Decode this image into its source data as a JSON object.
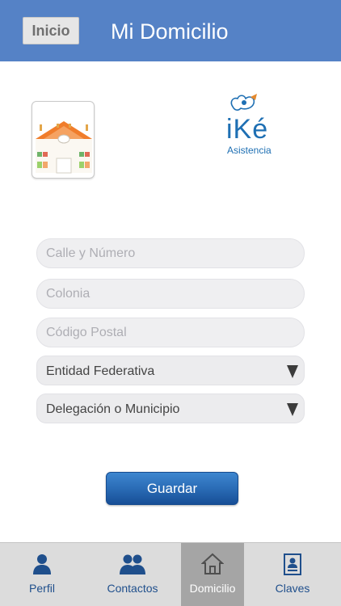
{
  "header": {
    "back_label": "Inicio",
    "title": "Mi Domicilio"
  },
  "logo": {
    "brand": "iKé",
    "subtitle": "Asistencia"
  },
  "form": {
    "street": {
      "placeholder": "Calle y Número",
      "value": ""
    },
    "colony": {
      "placeholder": "Colonia",
      "value": ""
    },
    "postal": {
      "placeholder": "Código Postal",
      "value": ""
    },
    "state": {
      "selected": "Entidad Federativa"
    },
    "municipality": {
      "selected": "Delegación o Municipio"
    }
  },
  "save_label": "Guardar",
  "tabs": [
    {
      "label": "Perfil",
      "icon": "person-icon",
      "active": false
    },
    {
      "label": "Contactos",
      "icon": "contacts-icon",
      "active": false
    },
    {
      "label": "Domicilio",
      "icon": "home-icon",
      "active": true
    },
    {
      "label": "Claves",
      "icon": "id-card-icon",
      "active": false
    }
  ],
  "colors": {
    "header": "#5582c6",
    "tab_text": "#1f4f8c",
    "tab_active_bg": "#a5a5a5",
    "button": "#2a6cb6"
  }
}
